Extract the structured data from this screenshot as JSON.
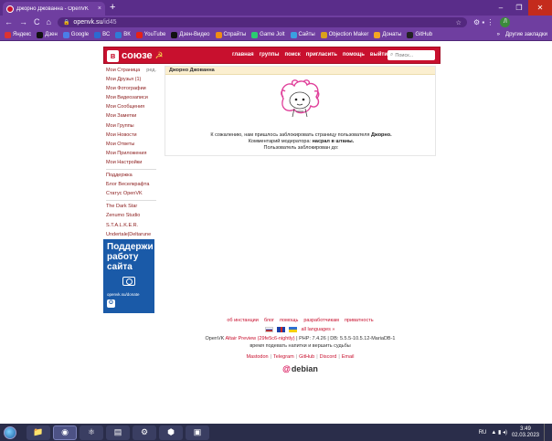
{
  "browser": {
    "tab_title": "Джорно Джованна - OpenVK",
    "tab_close": "×",
    "new_tab": "+",
    "nav_back": "←",
    "nav_forward": "→",
    "nav_reload": "C",
    "nav_home": "⌂",
    "url_host": "openvk.su",
    "url_path": "/id45",
    "omnibox_actions": "☆",
    "ext_icons": "⚙  ▪  ⋮",
    "profile_letter": "Л",
    "window_buttons": [
      "–",
      "❐",
      "✕"
    ],
    "bookmarks": [
      {
        "label": "Яндекс",
        "color": "#d33"
      },
      {
        "label": "Дзен",
        "color": "#111"
      },
      {
        "label": "Google",
        "color": "#4a7ee8"
      },
      {
        "label": "ВС",
        "color": "#2c6ad1"
      },
      {
        "label": "ВК",
        "color": "#2f7bd6"
      },
      {
        "label": "YouTube",
        "color": "#e62117"
      },
      {
        "label": "Дзен-Видео",
        "color": "#111"
      },
      {
        "label": "Спрайты",
        "color": "#f08c14"
      },
      {
        "label": "Game Jolt",
        "color": "#2bcc71"
      },
      {
        "label": "Сайты",
        "color": "#3aa0e0"
      },
      {
        "label": "Objection Maker",
        "color": "#d9a21b"
      },
      {
        "label": "Донаты",
        "color": "#f5a623"
      },
      {
        "label": "GitHub",
        "color": "#222"
      }
    ],
    "more_bookmarks": "»",
    "other_bookmarks": "Другие закладки"
  },
  "site": {
    "logo_letter": "в",
    "logo_text": "союзе",
    "logo_emblem": "☭",
    "top_nav": [
      "главная",
      "группы",
      "поиск",
      "пригласить",
      "помощь",
      "выйти"
    ],
    "search_placeholder": "Поиск...",
    "search_icon": "⌕",
    "sidebar_main": [
      {
        "label": "Мои Страница",
        "aux": "ред."
      },
      {
        "label": "Мои Друзья (1)",
        "aux": ""
      },
      {
        "label": "Мои Фотографии",
        "aux": ""
      },
      {
        "label": "Мои Видеозаписи",
        "aux": ""
      },
      {
        "label": "Мои Сообщения",
        "aux": ""
      },
      {
        "label": "Мои Заметки",
        "aux": ""
      },
      {
        "label": "Мои Группы",
        "aux": ""
      },
      {
        "label": "Мои Новости",
        "aux": ""
      },
      {
        "label": "Мои Ответы",
        "aux": ""
      },
      {
        "label": "Мои Приложения",
        "aux": ""
      },
      {
        "label": "Мои Настройки",
        "aux": ""
      }
    ],
    "sidebar_support": [
      "Поддержка",
      "Блог Веселкрафта",
      "Статус OpenVK"
    ],
    "sidebar_groups": [
      "The Dark Star",
      "Zenumo Studio",
      "S.T.A.L.K.E.R.",
      "Undertale|Deltarune"
    ],
    "donate": {
      "title": "Поддержи работу сайта",
      "url": "openvk.su/donate",
      "logo": "О"
    },
    "content": {
      "header": "Джорно Джованна",
      "msg_line1_pre": "К сожалению, нам пришлось заблокировать страницу пользователя",
      "msg_user": "Джорно.",
      "msg_line2_pre": "Комментарий модератора:",
      "msg_comment": "насрал в штаны.",
      "msg_line3": "Пользователь заблокирован до:"
    },
    "footer": {
      "links": [
        "об инстанции",
        "блог",
        "помощь",
        "разработчикам",
        "приватность"
      ],
      "all_languages": "all languages »",
      "version_pre": "OpenVK",
      "version_link": "Altair Preview (29fe5c6-nightly)",
      "version_post": "| PHP: 7.4.26 | DB: 5.5.5-10.5.12-MariaDB-1",
      "motto": "время подевать напитки и вершить судьбы",
      "social": [
        "Mastodon",
        "Telegram",
        "GitHub",
        "Discord",
        "Email"
      ],
      "social_sep": "|",
      "debian_mark": "@",
      "debian_text": "debian"
    }
  },
  "taskbar": {
    "apps": [
      "📁",
      "◉",
      "⚛",
      "▤",
      "⚙",
      "⬢",
      "▣"
    ],
    "lang": "RU",
    "tray_icons": "▲ ▮ ◂)",
    "time": "3:49",
    "date": "02.03.2023"
  }
}
